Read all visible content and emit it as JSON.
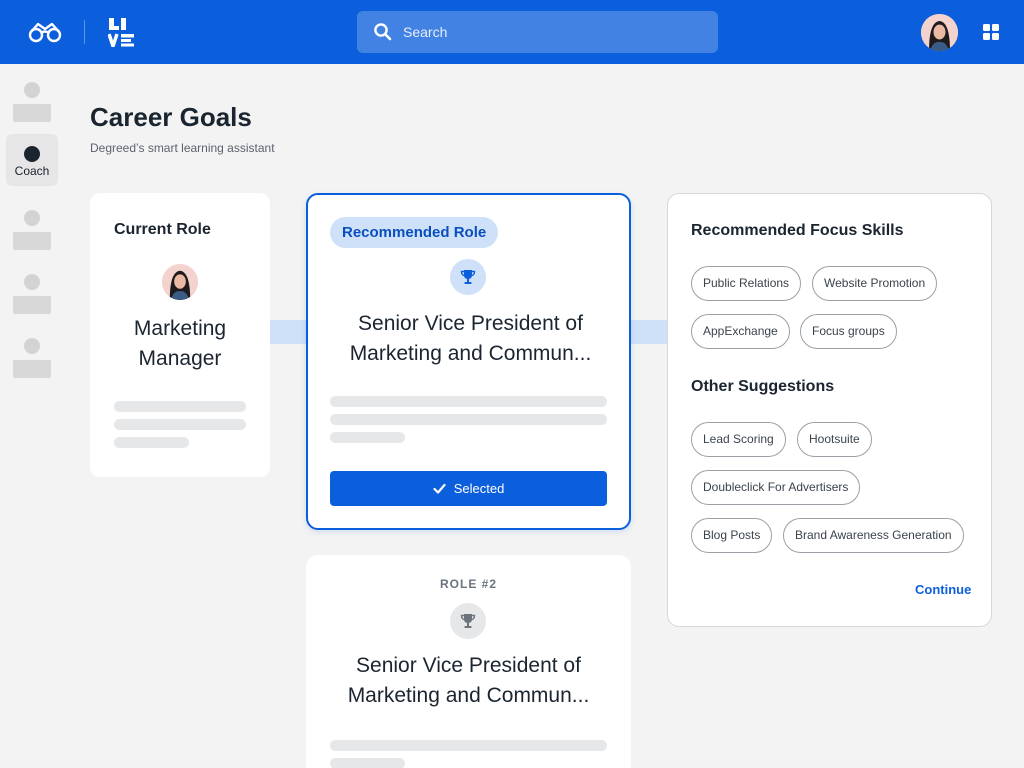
{
  "topbar": {
    "search_placeholder": "Search",
    "accent": "#0c5fdc"
  },
  "rail": {
    "items": [
      {
        "label": "",
        "active": false
      },
      {
        "label": "Coach",
        "active": true
      },
      {
        "label": "",
        "active": false
      },
      {
        "label": "",
        "active": false
      },
      {
        "label": "",
        "active": false
      }
    ]
  },
  "header": {
    "title": "Career Goals",
    "subtitle": "Degreed’s smart learning assistant"
  },
  "current_role": {
    "label": "Current Role",
    "name_line1": "Marketing",
    "name_line2": "Manager"
  },
  "recommended_role": {
    "badge": "Recommended Role",
    "title_line1": "Senior Vice President of",
    "title_line2": "Marketing and Commun...",
    "button_label": "Selected",
    "icon": "trophy-icon"
  },
  "role2": {
    "label": "ROLE #2",
    "title_line1": "Senior Vice President of",
    "title_line2": "Marketing and Commun...",
    "icon": "trophy-icon"
  },
  "skills_panel": {
    "focus_heading": "Recommended Focus Skills",
    "focus_skills": [
      "Public Relations",
      "Website Promotion",
      "AppExchange",
      "Focus groups"
    ],
    "other_heading": "Other Suggestions",
    "other_skills": [
      "Lead Scoring",
      "Hootsuite",
      "Doubleclick For Advertisers",
      "Blog Posts",
      "Brand Awareness Generation"
    ],
    "continue_label": "Continue"
  }
}
